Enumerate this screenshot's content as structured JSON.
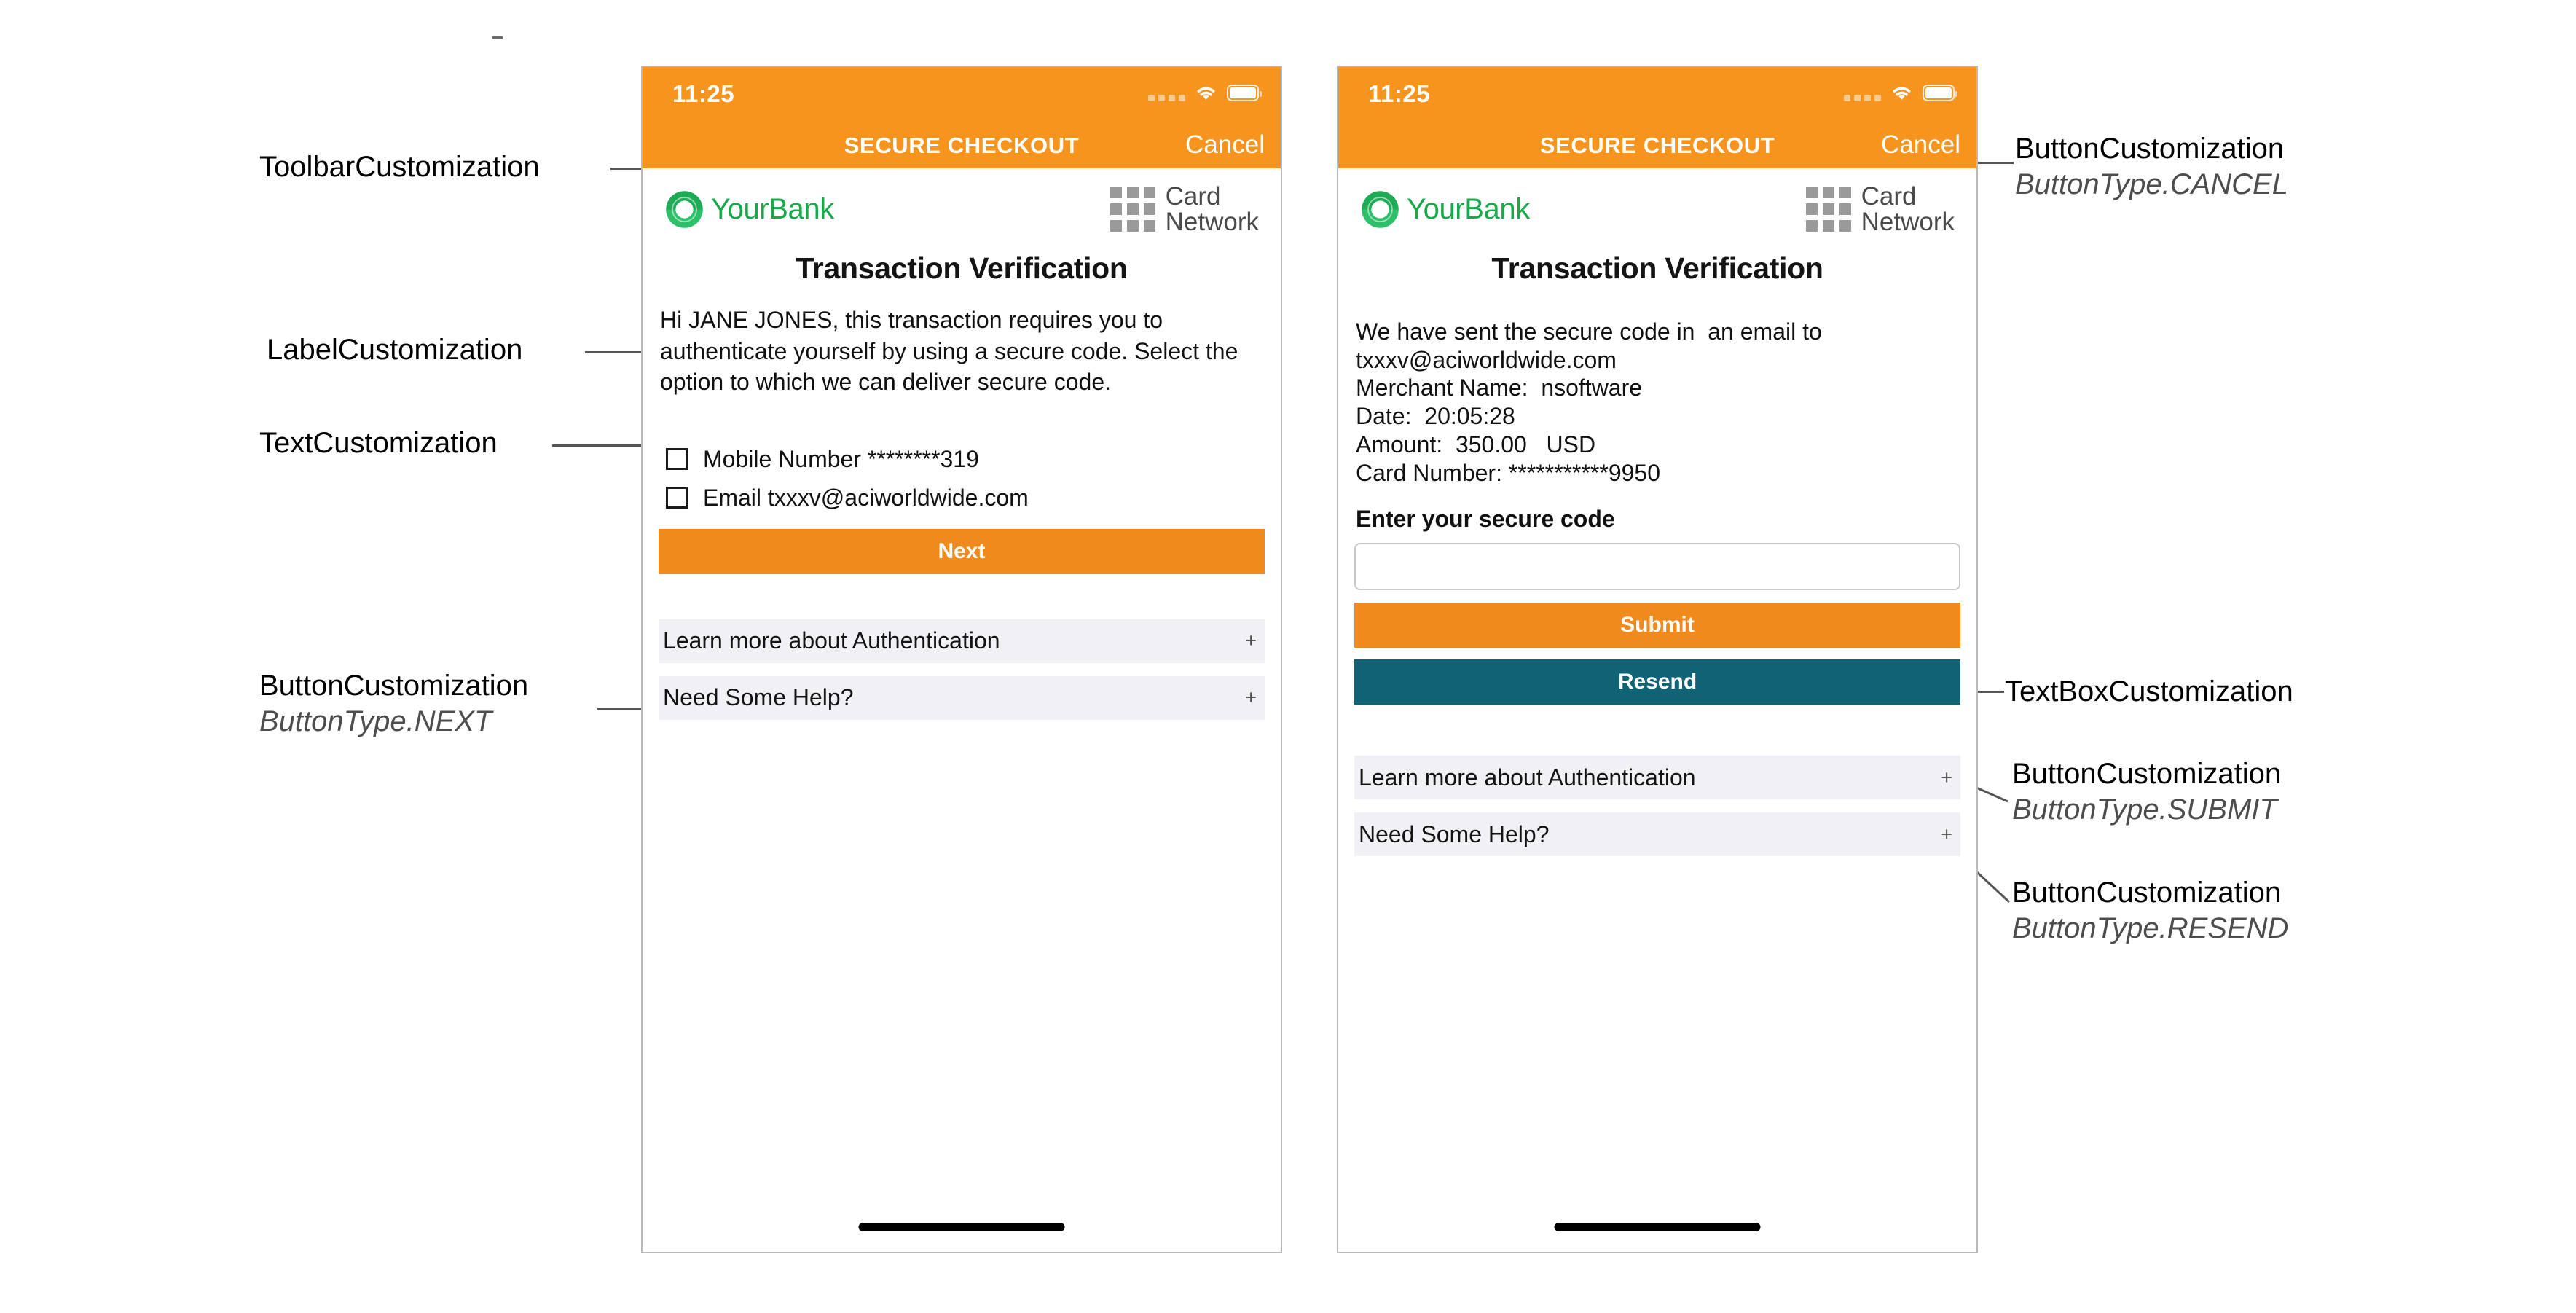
{
  "colors": {
    "orange_header": "#F7941E",
    "orange_button": "#F18A1C",
    "teal_button": "#0F6374",
    "accordion_bg": "#f1f0f4",
    "bank_green": "#17a94a",
    "card_network_gray": "#9a9a9a",
    "leader_line": "#555555"
  },
  "annotations": {
    "toolbar": {
      "title": "ToolbarCustomization",
      "subtitle": ""
    },
    "label": {
      "title": "LabelCustomization",
      "subtitle": ""
    },
    "text": {
      "title": "TextCustomization",
      "subtitle": ""
    },
    "button_next": {
      "title": "ButtonCustomization",
      "subtitle": "ButtonType.NEXT"
    },
    "button_cancel": {
      "title": "ButtonCustomization",
      "subtitle": "ButtonType.CANCEL"
    },
    "textbox": {
      "title": "TextBoxCustomization",
      "subtitle": ""
    },
    "button_submit": {
      "title": "ButtonCustomization",
      "subtitle": "ButtonType.SUBMIT"
    },
    "button_resend": {
      "title": "ButtonCustomization",
      "subtitle": "ButtonType.RESEND"
    }
  },
  "phone1": {
    "status": {
      "time": "11:25",
      "signal_icon": "signal-dots-icon",
      "wifi_icon": "wifi-icon",
      "battery_icon": "battery-icon"
    },
    "toolbar": {
      "title": "SECURE CHECKOUT",
      "cancel_label": "Cancel"
    },
    "brand": {
      "bank_name": "YourBank",
      "bank_mark_icon": "yourbank-ring-icon",
      "network_grid_icon": "card-network-grid-icon",
      "network_line1": "Card",
      "network_line2": "Network"
    },
    "page_title": "Transaction Verification",
    "body_text": "Hi JANE JONES, this transaction requires you to authenticate yourself by using a secure code. Select the option to which we can deliver secure code.",
    "options": [
      {
        "label": "Mobile Number ********319",
        "checked": false
      },
      {
        "label": "Email txxxv@aciworldwide.com",
        "checked": false
      }
    ],
    "next_label": "Next",
    "accordion": [
      {
        "label": "Learn more about Authentication",
        "toggle": "+"
      },
      {
        "label": "Need Some Help?",
        "toggle": "+"
      }
    ]
  },
  "phone2": {
    "status": {
      "time": "11:25",
      "signal_icon": "signal-dots-icon",
      "wifi_icon": "wifi-icon",
      "battery_icon": "battery-icon"
    },
    "toolbar": {
      "title": "SECURE CHECKOUT",
      "cancel_label": "Cancel"
    },
    "brand": {
      "bank_name": "YourBank",
      "bank_mark_icon": "yourbank-ring-icon",
      "network_grid_icon": "card-network-grid-icon",
      "network_line1": "Card",
      "network_line2": "Network"
    },
    "page_title": "Transaction Verification",
    "info_lines": [
      "We have sent the secure code in  an email to",
      "txxxv@aciworldwide.com",
      "Merchant Name:  nsoftware",
      "Date:  20:05:28",
      "Amount:  350.00   USD",
      "Card Number: ***********9950"
    ],
    "field_label": "Enter your secure code",
    "secure_code_value": "",
    "secure_code_placeholder": "",
    "submit_label": "Submit",
    "resend_label": "Resend",
    "accordion": [
      {
        "label": "Learn more about Authentication",
        "toggle": "+"
      },
      {
        "label": "Need Some Help?",
        "toggle": "+"
      }
    ]
  }
}
